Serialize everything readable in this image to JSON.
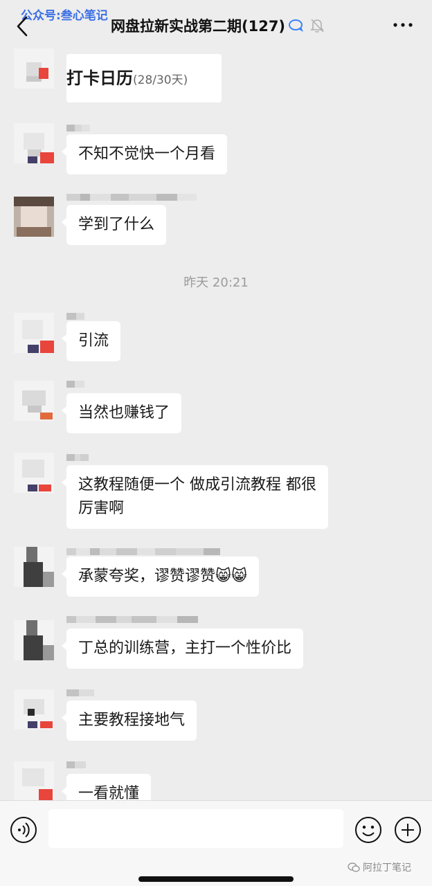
{
  "watermark": "公众号:叁心笔记",
  "header": {
    "title": "网盘拉新实战第二期(127)"
  },
  "messages": [
    {
      "text": "打卡日历",
      "sub": "(28/30天)"
    },
    {
      "text": "不知不觉快一个月看"
    },
    {
      "text": "学到了什么"
    },
    {
      "text": "引流"
    },
    {
      "text": "当然也赚钱了"
    },
    {
      "line1": "这教程随便一个 做成引流教程 都很",
      "line2": "厉害啊"
    },
    {
      "text": "承蒙夸奖，谬赞谬赞",
      "emoji": "😸😸"
    },
    {
      "text": "丁总的训练营，主打一个性价比"
    },
    {
      "text": "主要教程接地气"
    },
    {
      "text": "一看就懂"
    }
  ],
  "timestamp": "昨天 20:21",
  "footer": {
    "brand": "阿拉丁笔记"
  },
  "colors": {
    "background": "#ededed",
    "bubble": "#ffffff",
    "watermark": "#3b6fe6",
    "avatar_accent": "#e8453c"
  },
  "icons": {
    "back": "chevron-left-icon",
    "chat_search": "chat-bubble-icon",
    "mute": "bell-mute-icon",
    "more": "ellipsis-icon",
    "voice": "voice-icon",
    "emoji": "smiley-icon",
    "plus": "plus-circle-icon"
  }
}
